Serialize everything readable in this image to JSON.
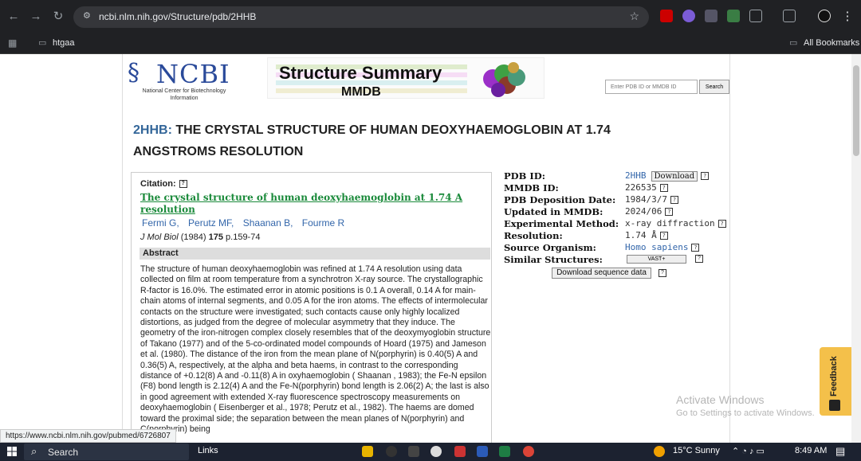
{
  "browser": {
    "url": "ncbi.nlm.nih.gov/Structure/pdb/2HHB",
    "bookmark_folder": "htgaa",
    "all_bookmarks": "All Bookmarks",
    "status_url": "https://www.ncbi.nlm.nih.gov/pubmed/6726807"
  },
  "header": {
    "logo_text": "NCBI",
    "logo_sub": "National Center for Biotechnology Information",
    "banner_title": "Structure Summary",
    "banner_sub": "MMDB",
    "search_placeholder": "Enter PDB ID or MMDB ID",
    "search_button": "Search"
  },
  "title": {
    "pdb": "2HHB:",
    "text": "THE CRYSTAL STRUCTURE OF HUMAN DEOXYHAEMOGLOBIN AT 1.74 ANGSTROMS RESOLUTION"
  },
  "citation": {
    "label": "Citation:",
    "title": "The crystal structure of human deoxyhaemoglobin at 1.74 A resolution",
    "authors": [
      "Fermi G,",
      "Perutz MF,",
      "Shaanan B,",
      "Fourme R"
    ],
    "journal": "J Mol Biol",
    "year": "(1984)",
    "volume": "175",
    "pages": "p.159-74",
    "abstract_label": "Abstract",
    "abstract": "The structure of human deoxyhaemoglobin was refined at 1.74 A resolution using data collected on film at room temperature from a synchrotron X-ray source. The crystallographic R-factor is 16.0%. The estimated error in atomic positions is 0.1 A overall, 0.14 A for main-chain atoms of internal segments, and 0.05 A for the iron atoms. The effects of intermolecular contacts on the structure were investigated; such contacts cause only highly localized distortions, as judged from the degree of molecular asymmetry that they induce. The geometry of the iron-nitrogen complex closely resembles that of the deoxymyoglobin structure of Takano (1977) and of the 5-co-ordinated model compounds of Hoard (1975) and Jameson et al. (1980). The distance of the iron from the mean plane of N(porphyrin) is 0.40(5) A and 0.36(5) A, respectively, at the alpha and beta haems, in contrast to the corresponding distance of +0.12(8) A and -0.11(8) A in oxyhaemoglobin ( Shaanan , 1983); the Fe-N epsilon (F8) bond length is 2.12(4) A and the Fe-N(porphyrin) bond length is 2.06(2) A; the last is also in good agreement with extended X-ray fluorescence spectroscopy measurements on deoxyhaemoglobin ( Eisenberger et al., 1978; Perutz et al., 1982). The haems are domed toward the proximal side; the separation between the mean planes of N(porphyrin) and C(porphyrin) being"
  },
  "info": {
    "pdb_id_label": "PDB ID:",
    "pdb_id": "2HHB",
    "download": "Download",
    "mmdb_id_label": "MMDB ID:",
    "mmdb_id": "226535",
    "deposition_label": "PDB Deposition Date:",
    "deposition": "1984/3/7",
    "updated_label": "Updated in MMDB:",
    "updated": "2024/06",
    "method_label": "Experimental Method:",
    "method": "x-ray diffraction",
    "resolution_label": "Resolution:",
    "resolution": "1.74  Å",
    "organism_label": "Source Organism:",
    "organism": "Homo sapiens",
    "similar_label": "Similar Structures:",
    "vast": "VAST+",
    "download_seq": "Download sequence data"
  },
  "overlay": {
    "activate1": "Activate Windows",
    "activate2": "Go to Settings to activate Windows.",
    "feedback": "Feedback"
  },
  "taskbar": {
    "search": "Search",
    "links": "Links",
    "weather": "15°C  Sunny",
    "time": "8:49 AM"
  }
}
